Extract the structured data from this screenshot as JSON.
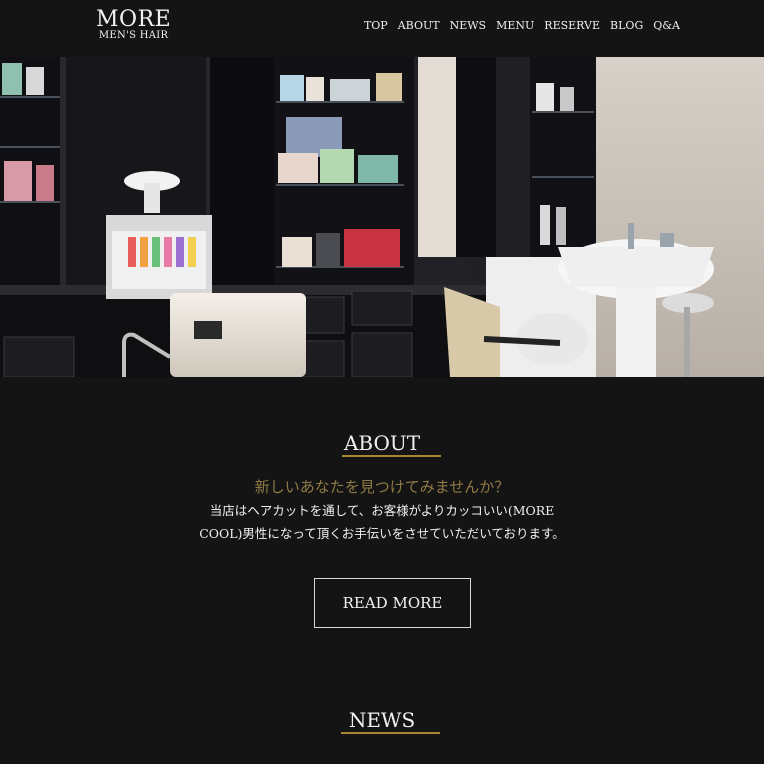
{
  "header": {
    "logo_main": "MORE",
    "logo_sub": "MEN'S HAIR",
    "nav": [
      "TOP",
      "ABOUT",
      "NEWS",
      "MENU",
      "RESERVE",
      "BLOG",
      "Q&A"
    ]
  },
  "about": {
    "title": "ABOUT",
    "tagline": "新しいあなたを見つけてみませんか？",
    "desc_line1": "当店はヘアカットを通して、お客様がよりカッコいい(MORE",
    "desc_line2": "COOL)男性になって頂くお手伝いをさせていただいております。",
    "button": "READ MORE"
  },
  "news": {
    "title": "NEWS"
  },
  "colors": {
    "background": "#141414",
    "accent_gold": "#a8872e",
    "tagline_gold": "#8e7a44"
  }
}
